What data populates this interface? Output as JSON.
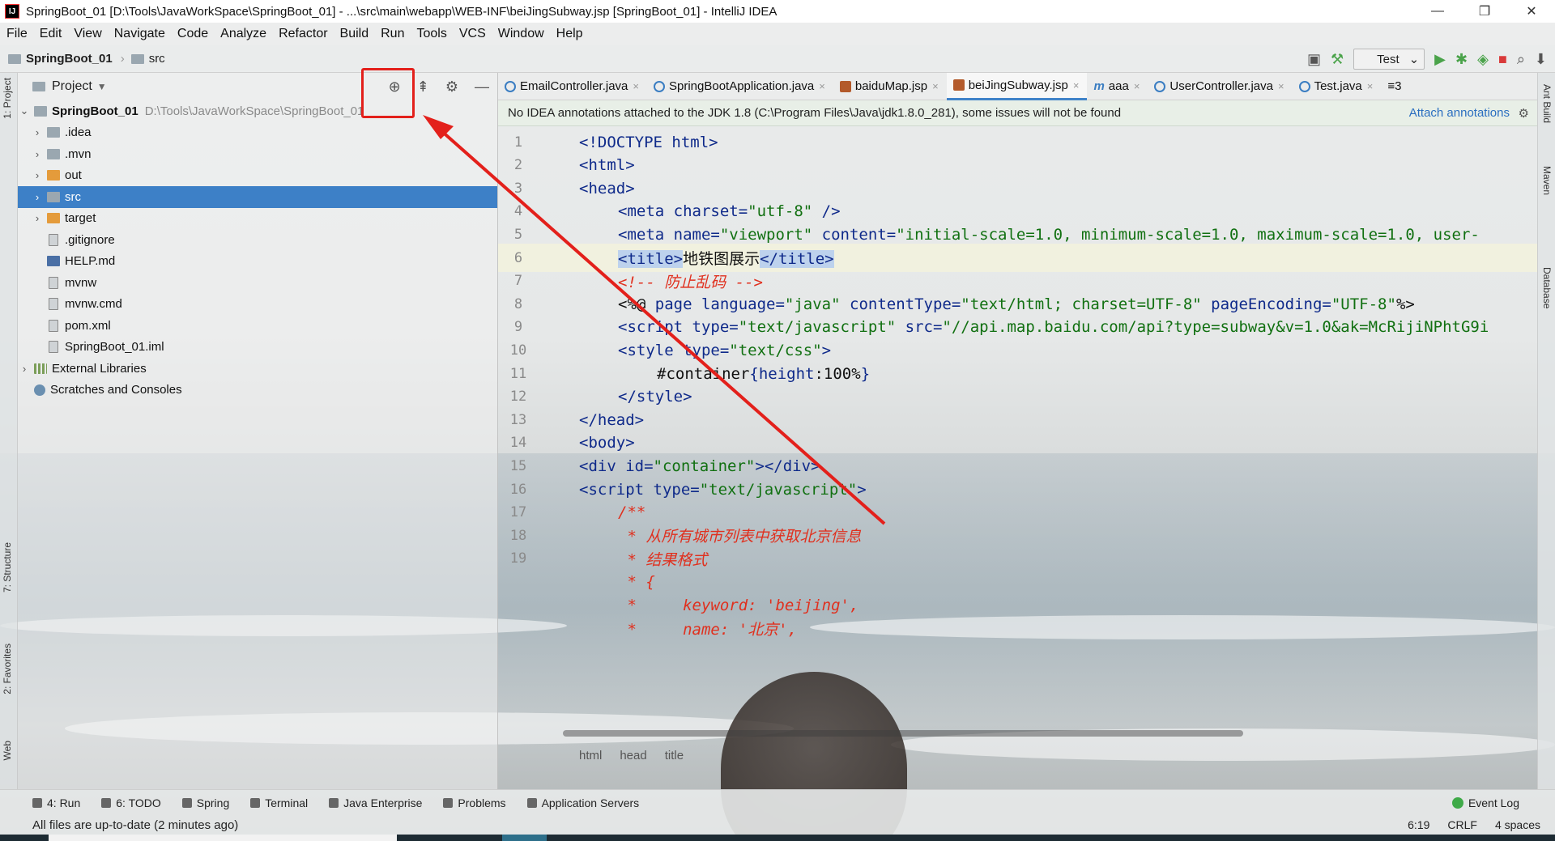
{
  "window": {
    "title": "SpringBoot_01 [D:\\Tools\\JavaWorkSpace\\SpringBoot_01] - ...\\src\\main\\webapp\\WEB-INF\\beiJingSubway.jsp [SpringBoot_01] - IntelliJ IDEA",
    "app_icon": "IJ",
    "minimize": "—",
    "restore": "❐",
    "close": "✕"
  },
  "menu": [
    "File",
    "Edit",
    "View",
    "Navigate",
    "Code",
    "Analyze",
    "Refactor",
    "Build",
    "Run",
    "Tools",
    "VCS",
    "Window",
    "Help"
  ],
  "navbar": {
    "project": "SpringBoot_01",
    "folder": "src",
    "run_config": "Test"
  },
  "left_strip": {
    "project_tab": "1: Project",
    "structure_tab": "7: Structure",
    "favorites_tab": "2: Favorites",
    "web_tab": "Web"
  },
  "right_strip": {
    "ant_tab": "Ant Build",
    "maven_tab": "Maven",
    "database_tab": "Database"
  },
  "project_panel": {
    "title": "Project",
    "root": "SpringBoot_01",
    "root_path": "D:\\Tools\\JavaWorkSpace\\SpringBoot_01",
    "items": [
      {
        "label": ".idea",
        "type": "folder"
      },
      {
        "label": ".mvn",
        "type": "folder"
      },
      {
        "label": "out",
        "type": "folder-o"
      },
      {
        "label": "src",
        "type": "folder",
        "selected": true
      },
      {
        "label": "target",
        "type": "folder-o"
      },
      {
        "label": ".gitignore",
        "type": "file"
      },
      {
        "label": "HELP.md",
        "type": "md"
      },
      {
        "label": "mvnw",
        "type": "file"
      },
      {
        "label": "mvnw.cmd",
        "type": "file"
      },
      {
        "label": "pom.xml",
        "type": "maven"
      },
      {
        "label": "SpringBoot_01.iml",
        "type": "file"
      }
    ],
    "external_libraries": "External Libraries",
    "scratches": "Scratches and Consoles"
  },
  "tabs": [
    {
      "label": "EmailController.java",
      "icon": "class"
    },
    {
      "label": "SpringBootApplication.java",
      "icon": "class"
    },
    {
      "label": "baiduMap.jsp",
      "icon": "jsp"
    },
    {
      "label": "beiJingSubway.jsp",
      "icon": "jsp",
      "active": true
    },
    {
      "label": "aaa",
      "icon": "m"
    },
    {
      "label": "UserController.java",
      "icon": "class"
    },
    {
      "label": "Test.java",
      "icon": "class"
    }
  ],
  "tabs_overflow": "≡3",
  "banner": {
    "message": "No IDEA annotations attached to the JDK 1.8 (C:\\Program Files\\Java\\jdk1.8.0_281), some issues will not be found",
    "action": "Attach annotations"
  },
  "code_lines": [
    {
      "n": "1",
      "parts": [
        [
          "tag",
          "<!DOCTYPE "
        ],
        [
          "attr",
          "html"
        ],
        [
          "tag",
          ">"
        ]
      ],
      "indent": 0
    },
    {
      "n": "2",
      "parts": [
        [
          "tag",
          "<html>"
        ]
      ],
      "indent": 0
    },
    {
      "n": "3",
      "parts": [
        [
          "tag",
          "<head>"
        ]
      ],
      "indent": 0
    },
    {
      "n": "4",
      "parts": [
        [
          "tag",
          "<meta "
        ],
        [
          "attr",
          "charset="
        ],
        [
          "str",
          "\"utf-8\""
        ],
        [
          "tag",
          " />"
        ]
      ],
      "indent": 1
    },
    {
      "n": "5",
      "parts": [
        [
          "tag",
          "<meta "
        ],
        [
          "attr",
          "name="
        ],
        [
          "str",
          "\"viewport\""
        ],
        [
          "attr",
          " content="
        ],
        [
          "str",
          "\"initial-scale=1.0, minimum-scale=1.0, maximum-scale=1.0, user-"
        ]
      ],
      "indent": 1
    },
    {
      "n": "6",
      "parts": [
        [
          "hl",
          "<title>"
        ],
        [
          "plain",
          "地铁图展示"
        ],
        [
          "hl",
          "</title>"
        ]
      ],
      "indent": 1,
      "current": true
    },
    {
      "n": "7",
      "parts": [
        [
          "cmt",
          "<!-- 防止乱码 -->"
        ]
      ],
      "indent": 1
    },
    {
      "n": "8",
      "parts": [
        [
          "plain",
          "<%@ "
        ],
        [
          "attr",
          "page language="
        ],
        [
          "str",
          "\"java\""
        ],
        [
          "attr",
          " contentType="
        ],
        [
          "str",
          "\"text/html; charset=UTF-8\""
        ],
        [
          "attr",
          " pageEncoding="
        ],
        [
          "str",
          "\"UTF-8\""
        ],
        [
          "plain",
          "%>"
        ]
      ],
      "indent": 1
    },
    {
      "n": "9",
      "parts": [
        [
          "tag",
          "<script "
        ],
        [
          "attr",
          "type="
        ],
        [
          "str",
          "\"text/javascript\""
        ],
        [
          "attr",
          " src="
        ],
        [
          "str",
          "\"//api.map.baidu.com/api?type=subway&v=1.0&ak=McRijiNPhtG9i"
        ]
      ],
      "indent": 1
    },
    {
      "n": "10",
      "parts": [
        [
          "tag",
          "<style "
        ],
        [
          "attr",
          "type="
        ],
        [
          "str",
          "\"text/css\""
        ],
        [
          "tag",
          ">"
        ]
      ],
      "indent": 1
    },
    {
      "n": "11",
      "parts": [
        [
          "plain",
          "#container"
        ],
        [
          "tag",
          "{"
        ],
        [
          "attr",
          "height"
        ],
        [
          "plain",
          ":100%"
        ],
        [
          "tag",
          "}"
        ]
      ],
      "indent": 2
    },
    {
      "n": "12",
      "parts": [
        [
          "tag",
          "</style>"
        ]
      ],
      "indent": 1
    },
    {
      "n": "13",
      "parts": [
        [
          "tag",
          "</head>"
        ]
      ],
      "indent": 0
    },
    {
      "n": "14",
      "parts": [
        [
          "tag",
          "<body>"
        ]
      ],
      "indent": 0
    },
    {
      "n": "15",
      "parts": [
        [
          "tag",
          "<div "
        ],
        [
          "attr",
          "id="
        ],
        [
          "str",
          "\"container\""
        ],
        [
          "tag",
          "></div>"
        ]
      ],
      "indent": 0
    },
    {
      "n": "16",
      "parts": [
        [
          "tag",
          "<script "
        ],
        [
          "attr",
          "type="
        ],
        [
          "str",
          "\"text/javascript\""
        ],
        [
          "tag",
          ">"
        ]
      ],
      "indent": 0
    },
    {
      "n": "17",
      "parts": [
        [
          "cmt",
          "/**"
        ]
      ],
      "indent": 1
    },
    {
      "n": "18",
      "parts": [
        [
          "cmt",
          " * 从所有城市列表中获取北京信息"
        ]
      ],
      "indent": 1
    },
    {
      "n": "19",
      "parts": [
        [
          "cmt",
          " * 结果格式"
        ]
      ],
      "indent": 1
    },
    {
      "n": "",
      "parts": [
        [
          "cmt",
          " * {"
        ]
      ],
      "indent": 1
    },
    {
      "n": "",
      "parts": [
        [
          "cmt",
          " *     keyword: 'beijing',"
        ]
      ],
      "indent": 1
    },
    {
      "n": "",
      "parts": [
        [
          "cmt",
          " *     name: '北京',"
        ]
      ],
      "indent": 1
    }
  ],
  "editor_breadcrumb": [
    "html",
    "head",
    "title"
  ],
  "bottom_tabs": [
    {
      "label": "4: Run",
      "icon": "run-icon"
    },
    {
      "label": "6: TODO",
      "icon": "todo-icon"
    },
    {
      "label": "Spring",
      "icon": "spring-icon"
    },
    {
      "label": "Terminal",
      "icon": "terminal-icon"
    },
    {
      "label": "Java Enterprise",
      "icon": "java-enterprise-icon"
    },
    {
      "label": "Problems",
      "icon": "problems-icon"
    },
    {
      "label": "Application Servers",
      "icon": "app-servers-icon"
    }
  ],
  "event_log": "Event Log",
  "status": {
    "message": "All files are up-to-date (2 minutes ago)",
    "position": "6:19",
    "line_sep": "CRLF",
    "indent": "4 spaces"
  },
  "colors": {
    "accent": "#3d80c7",
    "annotation_red": "#e3201b"
  }
}
